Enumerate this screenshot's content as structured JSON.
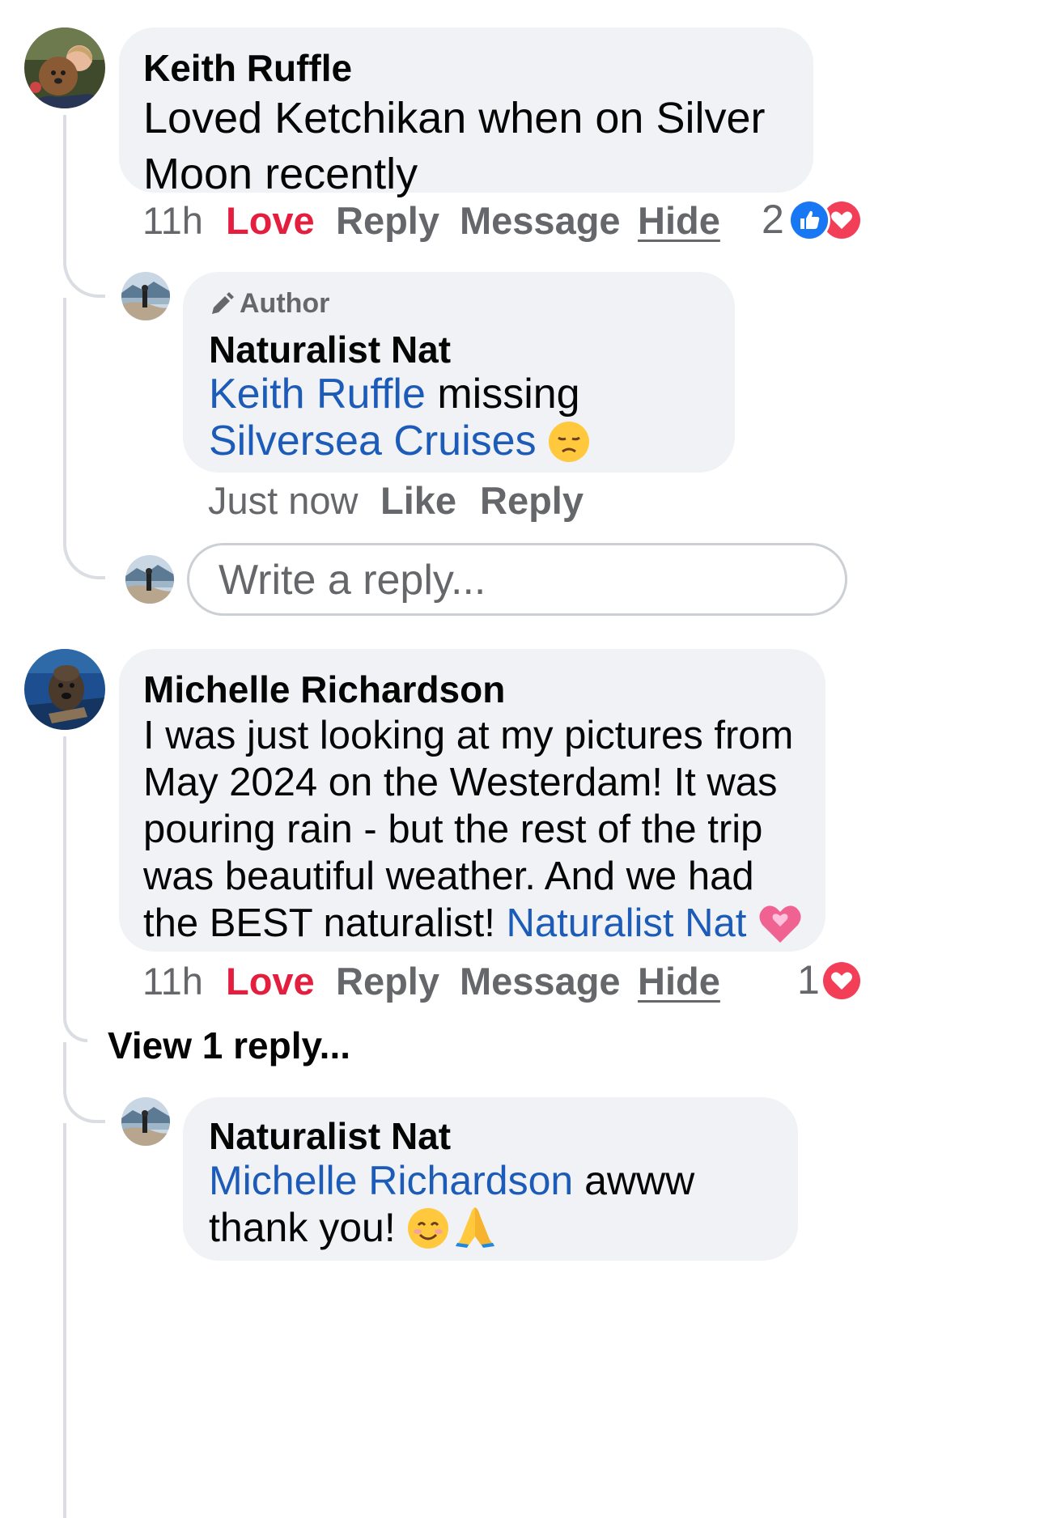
{
  "comments": [
    {
      "author": "Keith Ruffle",
      "text": "Loved Ketchikan when on Silver Moon recently",
      "time": "11h",
      "actions": {
        "love": "Love",
        "reply": "Reply",
        "message": "Message",
        "hide": "Hide"
      },
      "reaction_count": "2",
      "reactions": [
        "like-icon",
        "love-icon"
      ],
      "replies": [
        {
          "badge": "Author",
          "author": "Naturalist Nat",
          "mention1": "Keith Ruffle",
          "middle": " missing ",
          "mention2": "Silversea Cruises",
          "emoji": "disappointed-face-emoji",
          "time": "Just now",
          "actions": {
            "like": "Like",
            "reply": "Reply"
          }
        }
      ],
      "reply_input": {
        "placeholder": "Write a reply..."
      }
    },
    {
      "author": "Michelle Richardson",
      "text": "I was just looking at my pictures from May 2024 on the Westerdam! It was pouring rain - but the rest of the trip was beautiful weather. And we had the BEST naturalist! ",
      "mention": "Naturalist Nat",
      "emoji": "pink-heart-emoji",
      "time": "11h",
      "actions": {
        "love": "Love",
        "reply": "Reply",
        "message": "Message",
        "hide": "Hide"
      },
      "reaction_count": "1",
      "reactions": [
        "love-icon"
      ],
      "view_replies": "View 1 reply...",
      "replies": [
        {
          "author": "Naturalist Nat",
          "mention": "Michelle Richardson",
          "text": " awww thank you! ",
          "emojis": [
            "smiling-face-emoji",
            "folded-hands-emoji"
          ]
        }
      ]
    }
  ],
  "colors": {
    "link": "#1c5bb8",
    "love": "#e41e3f",
    "like": "#1877f2",
    "bubble": "#f0f2f5",
    "meta": "#65676b"
  }
}
